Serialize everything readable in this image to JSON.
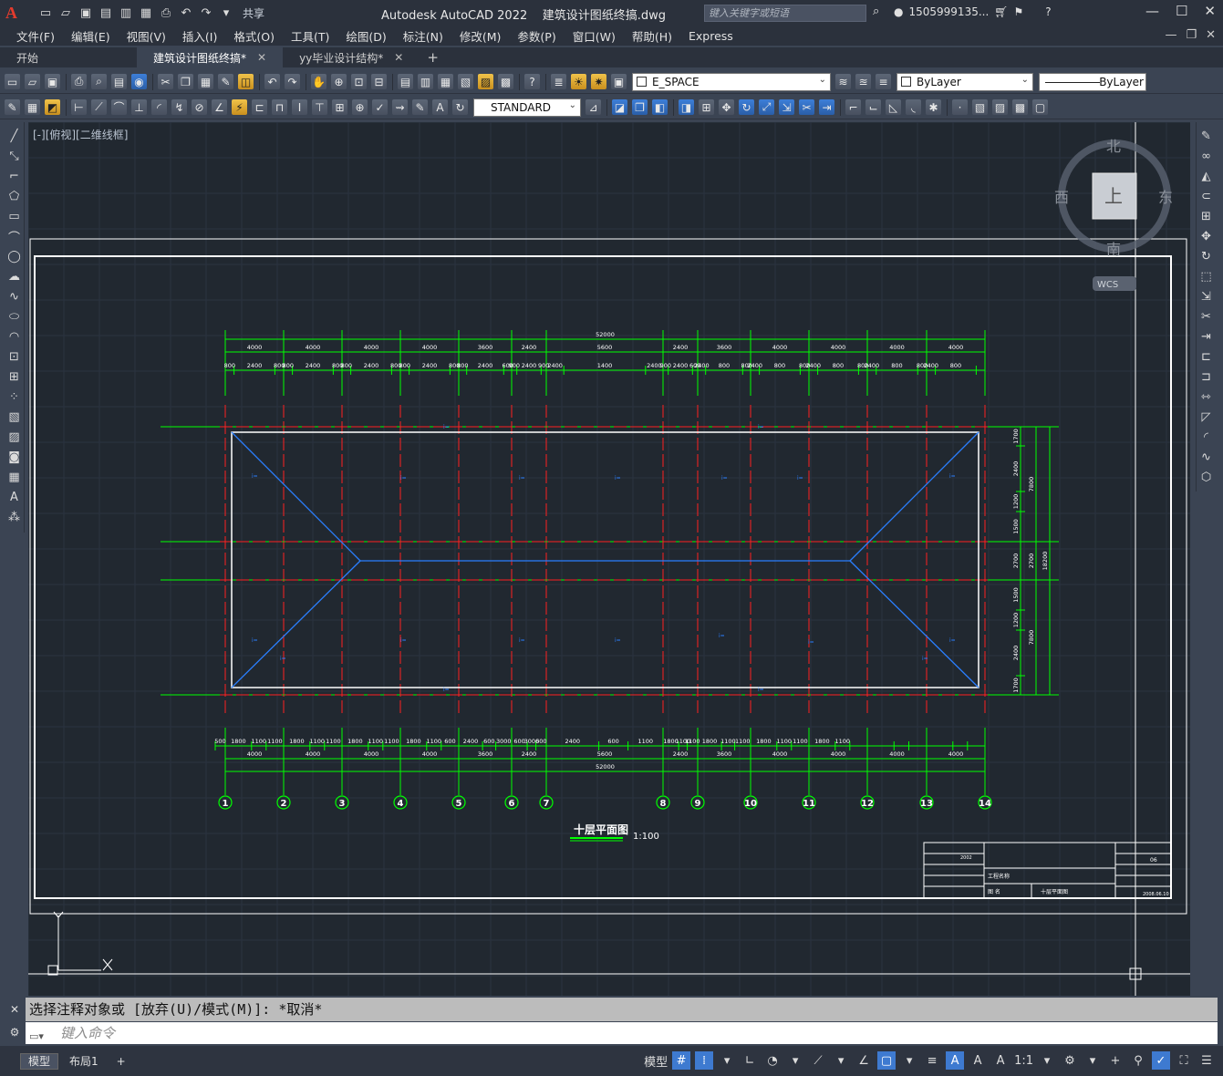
{
  "app": {
    "title": "Autodesk AutoCAD 2022",
    "file": "建筑设计图纸终搞.dwg",
    "search_placeholder": "键入关键字或短语",
    "user": "1505999135...",
    "share": "共享"
  },
  "menu": [
    "文件(F)",
    "编辑(E)",
    "视图(V)",
    "插入(I)",
    "格式(O)",
    "工具(T)",
    "绘图(D)",
    "标注(N)",
    "修改(M)",
    "参数(P)",
    "窗口(W)",
    "帮助(H)",
    "Express"
  ],
  "tabs": [
    {
      "label": "开始",
      "active": false,
      "closable": false
    },
    {
      "label": "建筑设计图纸终搞*",
      "active": true,
      "closable": true
    },
    {
      "label": "yy毕业设计结构*",
      "active": false,
      "closable": true
    }
  ],
  "toolbar": {
    "layer": "E_SPACE",
    "color": "ByLayer",
    "linetype": "ByLayer",
    "textstyle": "STANDARD"
  },
  "viewport": {
    "label": "[-][俯视][二维线框]",
    "viewcube": {
      "north": "北",
      "south": "南",
      "east": "东",
      "west": "西",
      "top": "上",
      "wcs": "WCS"
    }
  },
  "drawing": {
    "title": "十层平面图",
    "scale": "1:100",
    "total_top": "52000",
    "total_bottom": "52000",
    "total_right": "18200",
    "top_spans": [
      "4000",
      "4000",
      "4000",
      "4000",
      "3600",
      "2400",
      "5600",
      "2400",
      "3600",
      "4000",
      "4000",
      "4000",
      "4000"
    ],
    "top_sub": [
      "800",
      "2400",
      "800",
      "800",
      "2400",
      "800",
      "800",
      "2400",
      "800",
      "800",
      "2400",
      "800",
      "800",
      "2400",
      "600",
      "900",
      "2400",
      "900",
      "2400",
      "1400",
      "2400",
      "900",
      "2400",
      "600",
      "2400",
      "800",
      "800",
      "2400",
      "800",
      "800",
      "2400",
      "800",
      "800",
      "2400",
      "800",
      "800",
      "2400",
      "800"
    ],
    "bottom_spans": [
      "4000",
      "4000",
      "4000",
      "4000",
      "3600",
      "2400",
      "5600",
      "2400",
      "3600",
      "4000",
      "4000",
      "4000",
      "4000"
    ],
    "bottom_sub": [
      "500",
      "1800",
      "1100",
      "1100",
      "1800",
      "1100",
      "1100",
      "1800",
      "1100",
      "1100",
      "1800",
      "1100",
      "600",
      "2400",
      "600",
      "3000",
      "600",
      "3000",
      "600",
      "2400",
      "600",
      "1100",
      "1800",
      "1100",
      "1100",
      "1800",
      "1100",
      "1100",
      "1800",
      "1100",
      "1100",
      "1800",
      "1100"
    ],
    "axes": [
      "1",
      "2",
      "3",
      "4",
      "5",
      "6",
      "7",
      "8",
      "9",
      "10",
      "11",
      "12",
      "13",
      "14"
    ],
    "right_sub": [
      "1700",
      "2400",
      "1200",
      "1500",
      "2700",
      "1500",
      "1200",
      "2400",
      "1700"
    ],
    "right_mid": [
      "7800",
      "2700",
      "7800"
    ],
    "titleblock": {
      "project_label": "工程名称",
      "drawing_label": "图 名",
      "drawing_name": "十层平面图",
      "sheet": "06",
      "date": "2008.06.10",
      "year": "2002"
    }
  },
  "command": {
    "history": "选择注释对象或 [放弃(U)/模式(M)]: *取消*",
    "placeholder": "键入命令"
  },
  "status": {
    "layout_tabs": [
      "模型",
      "布局1"
    ],
    "model": "模型",
    "scale": "1:1"
  }
}
